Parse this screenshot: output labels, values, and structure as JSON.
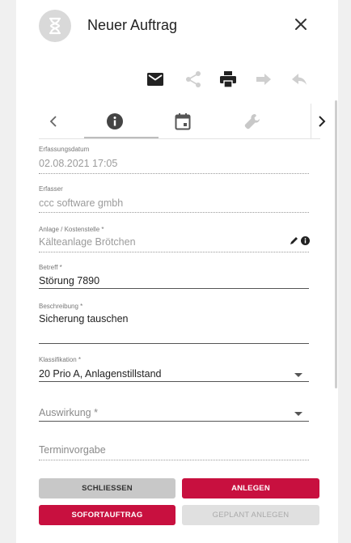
{
  "header": {
    "title": "Neuer Auftrag",
    "avatar_icon": "hourglass-icon",
    "close_icon": "close-icon"
  },
  "toolbar": {
    "icons": [
      "mail-icon",
      "share-icon",
      "print-icon",
      "forward-icon",
      "reply-icon"
    ]
  },
  "tabs": {
    "items": [
      "info-icon",
      "calendar-icon",
      "wrench-icon"
    ],
    "active": "info-icon",
    "prev_icon": "chevron-left-icon",
    "next_icon": "chevron-right-icon"
  },
  "form": {
    "erfassungsdatum": {
      "label": "Erfassungsdatum",
      "value": "02.08.2021 17:05"
    },
    "erfasser": {
      "label": "Erfasser",
      "value": "ccc software gmbh"
    },
    "anlage": {
      "label": "Anlage / Kostenstelle *",
      "value": "Kälteanlage Brötchen"
    },
    "betreff": {
      "label": "Betreff *",
      "value": "Störung 7890"
    },
    "beschreibung": {
      "label": "Beschreibung *",
      "value": "Sicherung tauschen"
    },
    "klassifikation": {
      "label": "Klassifikation *",
      "value": "20 Prio A, Anlagenstillstand"
    },
    "auswirkung": {
      "placeholder": "Auswirkung *"
    },
    "terminvorgabe": {
      "placeholder": "Terminvorgabe"
    }
  },
  "buttons": {
    "schliessen": "SCHLIESSEN",
    "anlegen": "ANLEGEN",
    "sofortauftrag": "SOFORTAUFTRAG",
    "geplant_anlegen": "GEPLANT ANLEGEN"
  },
  "colors": {
    "accent": "#c8103f",
    "button_grey": "#c8c8c8",
    "button_disabled": "#e0e0e0",
    "avatar_bg": "#d9d9d9"
  }
}
